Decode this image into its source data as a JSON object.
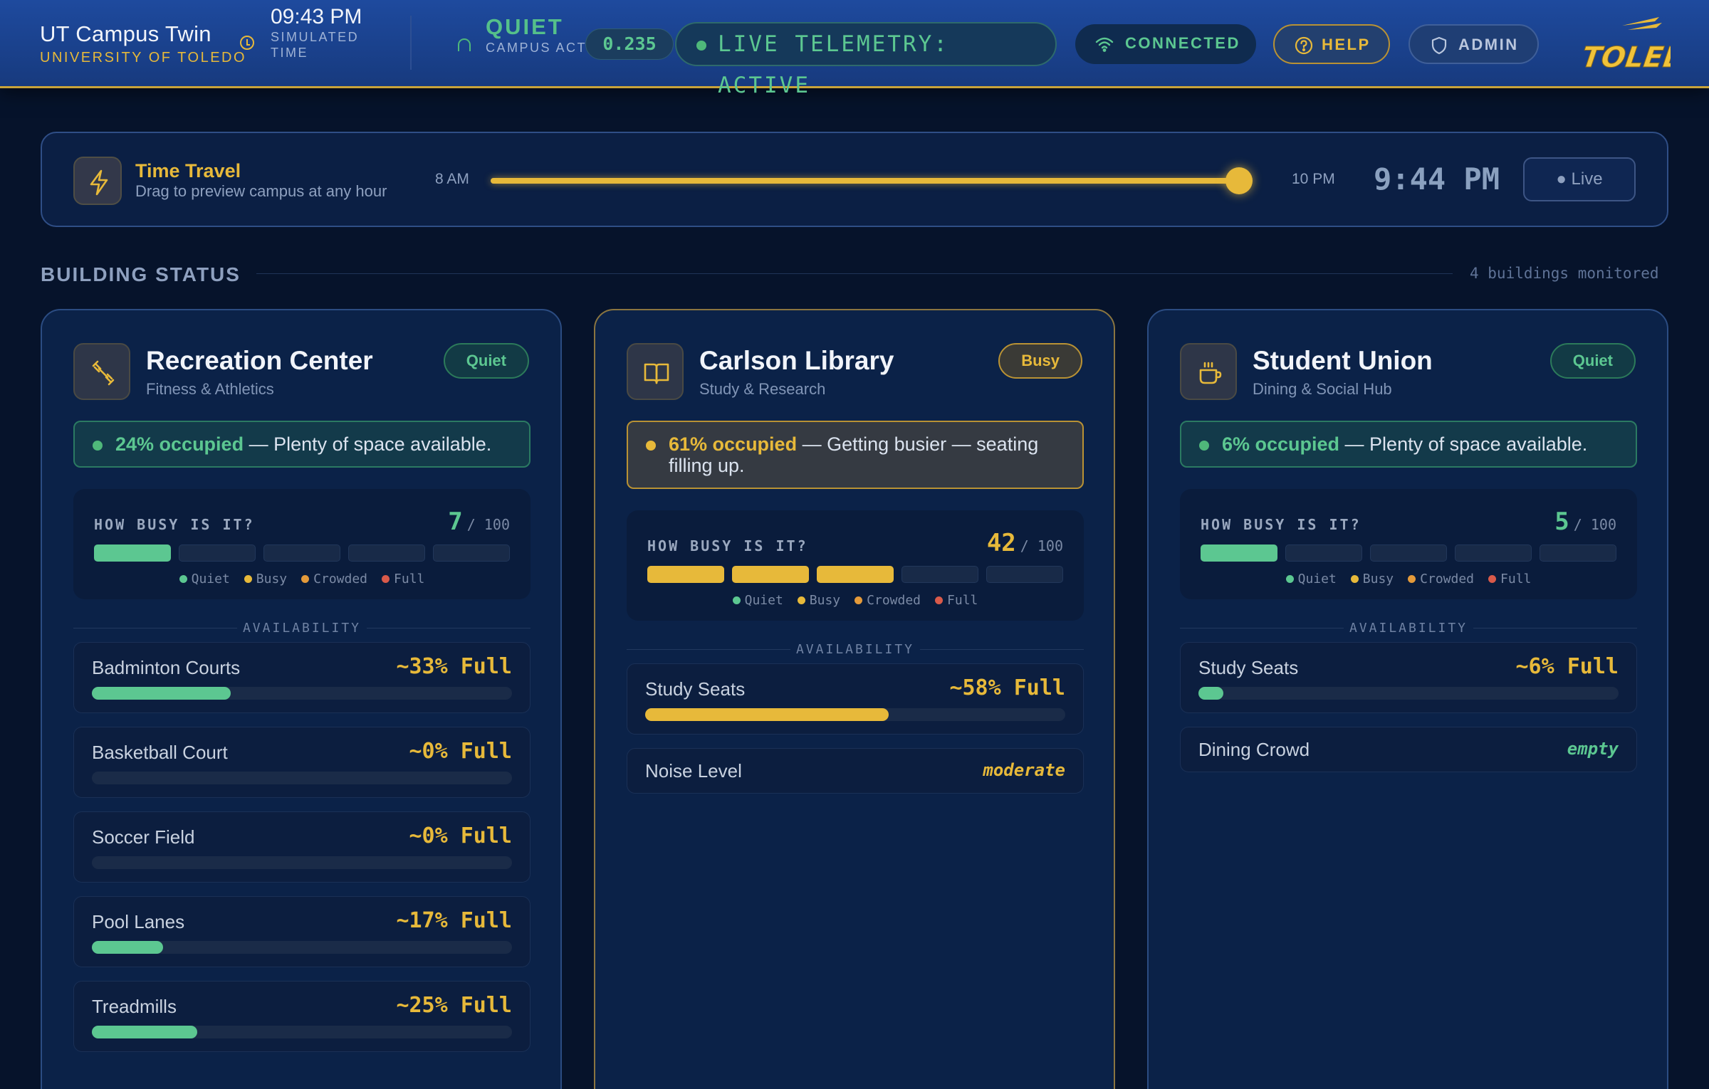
{
  "colors": {
    "quiet": "#5cc791",
    "busy": "#e7b93a",
    "crowded": "#e49a3a",
    "full": "#d95a4a",
    "accent": "#e7b93a"
  },
  "header": {
    "title": "UT Campus Twin",
    "subtitle": "UNIVERSITY OF TOLEDO",
    "clock_icon": "clock-icon",
    "sim_time": "09:43 PM",
    "sim_time_label": "SIMULATED TIME",
    "activity_icon": "gauge-icon",
    "activity_state": "QUIET",
    "activity_label": "CAMPUS ACTIVITY",
    "activity_score": "0.235",
    "telemetry": "LIVE TELEMETRY: ACTIVE",
    "connected": "CONNECTED",
    "help": "HELP",
    "admin": "ADMIN",
    "logo": "TOLEDO"
  },
  "time_travel": {
    "icon": "lightning-icon",
    "title": "Time Travel",
    "subtitle": "Drag to preview campus at any hour",
    "start": "8 AM",
    "end": "10 PM",
    "position": 0.988,
    "time": "9:44 PM",
    "live": "● Live"
  },
  "section": {
    "title": "BUILDING STATUS",
    "count": "4 buildings monitored"
  },
  "buildings": [
    {
      "icon": "dumbbell-icon",
      "name": "Recreation Center",
      "sub": "Fitness & Athletics",
      "badge": "Quiet",
      "status": "quiet",
      "occ_pct": "24% occupied",
      "occ_msg": " — Plenty of space available.",
      "meter_label": "HOW BUSY IS IT?",
      "meter_value": "7",
      "meter_max": "/ 100",
      "segments_filled": 1,
      "legend": [
        "Quiet",
        "Busy",
        "Crowded",
        "Full"
      ],
      "availability": "AVAILABILITY",
      "items": [
        {
          "name": "Badminton Courts",
          "pct": "~33% Full",
          "level": 0.33
        },
        {
          "name": "Basketball Court",
          "pct": "~0% Full",
          "level": 0
        },
        {
          "name": "Soccer Field",
          "pct": "~0% Full",
          "level": 0
        },
        {
          "name": "Pool Lanes",
          "pct": "~17% Full",
          "level": 0.17
        },
        {
          "name": "Treadmills",
          "pct": "~25% Full",
          "level": 0.25
        }
      ]
    },
    {
      "icon": "book-icon",
      "name": "Carlson Library",
      "sub": "Study & Research",
      "badge": "Busy",
      "status": "busy",
      "occ_pct": "61% occupied",
      "occ_msg": " — Getting busier — seating filling up.",
      "meter_label": "HOW BUSY IS IT?",
      "meter_value": "42",
      "meter_max": "/ 100",
      "segments_filled": 3,
      "legend": [
        "Quiet",
        "Busy",
        "Crowded",
        "Full"
      ],
      "availability": "AVAILABILITY",
      "items": [
        {
          "name": "Study Seats",
          "pct": "~58% Full",
          "level": 0.58
        },
        {
          "name": "Noise Level",
          "value": "moderate",
          "value_color": "#e7b93a"
        }
      ]
    },
    {
      "icon": "coffee-cup-icon",
      "name": "Student Union",
      "sub": "Dining & Social Hub",
      "badge": "Quiet",
      "status": "quiet",
      "occ_pct": "6% occupied",
      "occ_msg": " — Plenty of space available.",
      "meter_label": "HOW BUSY IS IT?",
      "meter_value": "5",
      "meter_max": "/ 100",
      "segments_filled": 1,
      "legend": [
        "Quiet",
        "Busy",
        "Crowded",
        "Full"
      ],
      "availability": "AVAILABILITY",
      "items": [
        {
          "name": "Study Seats",
          "pct": "~6% Full",
          "level": 0.06
        },
        {
          "name": "Dining Crowd",
          "value": "empty",
          "value_color": "#5cc791"
        }
      ]
    }
  ]
}
